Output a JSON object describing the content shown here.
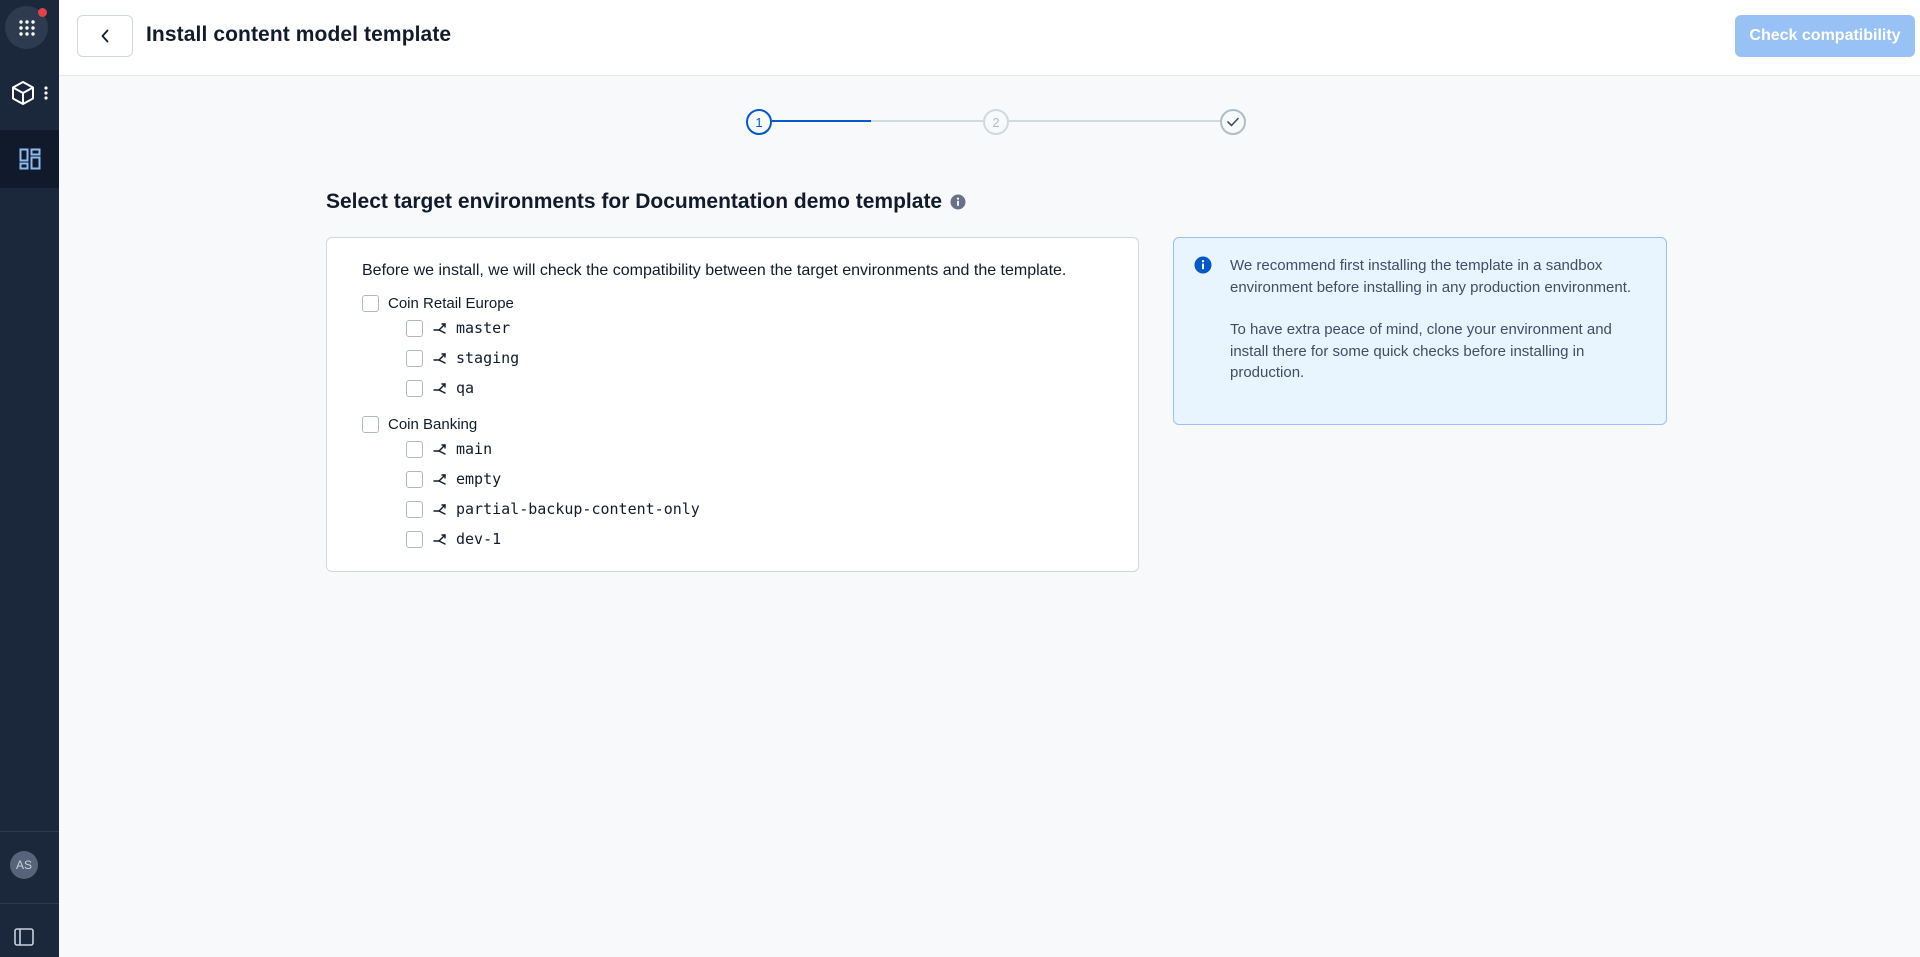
{
  "rail": {
    "avatar_initials": "AS",
    "icons": [
      "apps-grid-icon",
      "space-cube-icon",
      "more-vertical-icon",
      "dashboard-icon",
      "collapse-sidebar-icon"
    ]
  },
  "header": {
    "title": "Install content model template",
    "check_button": "Check compatibility"
  },
  "stepper": {
    "steps": [
      "1",
      "2"
    ],
    "current_step": 1,
    "final_icon": "check-icon"
  },
  "section": {
    "title": "Select target environments for Documentation demo template"
  },
  "card": {
    "intro": "Before we install, we will check the compatibility between the target environments and the template.",
    "orgs": [
      {
        "name": "Coin Retail Europe",
        "environments": [
          "master",
          "staging",
          "qa"
        ]
      },
      {
        "name": "Coin Banking",
        "environments": [
          "main",
          "empty",
          "partial-backup-content-only",
          "dev-1"
        ]
      }
    ]
  },
  "note": {
    "paragraph_1": "We recommend first installing the template in a sandbox environment before installing in any production environment.",
    "paragraph_2": "To have extra peace of mind, clone your environment and install there for some quick checks before installing in production."
  },
  "colors": {
    "rail_bg": "#1b273a",
    "primary": "#0059c8",
    "primary_disabled": "#98c1f6",
    "note_bg": "#e8f5ff"
  }
}
